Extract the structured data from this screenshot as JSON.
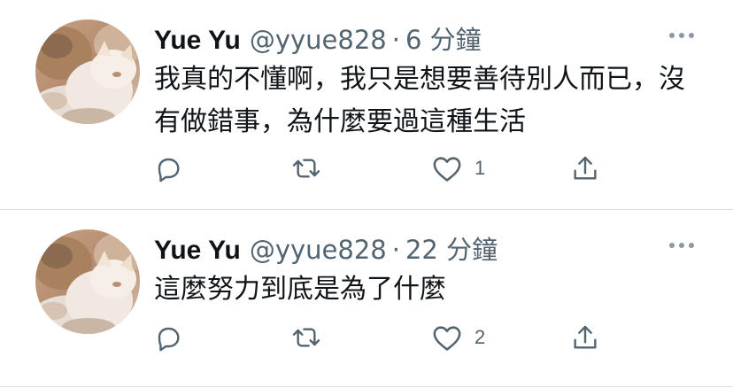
{
  "tweets": [
    {
      "display_name": "Yue Yu",
      "handle": "@yyue828",
      "separator": "·",
      "time": "6 分鐘",
      "body": "我真的不懂啊，我只是想要善待別人而已，沒有做錯事，為什麼要過這種生活",
      "likes": "1"
    },
    {
      "display_name": "Yue Yu",
      "handle": "@yyue828",
      "separator": "·",
      "time": "22 分鐘",
      "body": "這麼努力到底是為了什麼",
      "likes": "2"
    }
  ],
  "icons": {
    "reply": "reply-icon",
    "retweet": "retweet-icon",
    "like": "heart-icon",
    "share": "share-icon",
    "more": "more-icon"
  },
  "colors": {
    "text": "#0f1419",
    "secondary": "#536471",
    "divider": "#d8dde2"
  }
}
